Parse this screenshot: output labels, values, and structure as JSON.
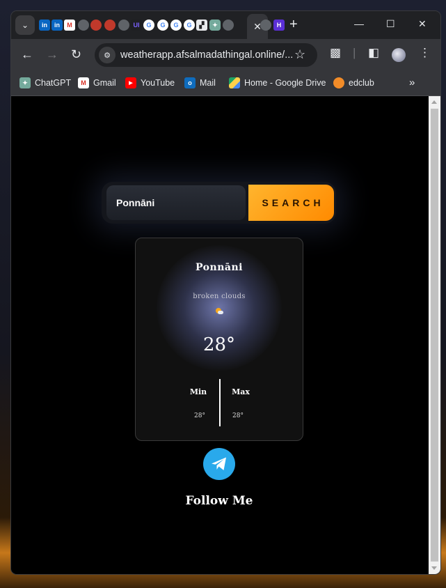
{
  "browser": {
    "tabs_menu_icon": "chevron-down-icon",
    "tab_favicons": [
      "linkedin",
      "linkedin",
      "gmail",
      "globe",
      "red-blob",
      "red-blob",
      "globe",
      "ui",
      "google",
      "google",
      "google",
      "google",
      "mixed",
      "chatgpt",
      "globe"
    ],
    "active_tab_close": "✕",
    "after_tabs_favicons": [
      "globe",
      "hc"
    ],
    "new_tab": "+",
    "url": "weatherapp.afsalmadathingal.online/...",
    "bookmarks": [
      {
        "label": "ChatGPT",
        "icon": "chatgpt-icon",
        "color": "#74aa9c"
      },
      {
        "label": "Gmail",
        "icon": "gmail-icon",
        "color": "#ffffff"
      },
      {
        "label": "YouTube",
        "icon": "youtube-icon",
        "color": "#ff0000"
      },
      {
        "label": "Mail",
        "icon": "outlook-icon",
        "color": "#0f6cbd"
      },
      {
        "label": "Home - Google Drive",
        "icon": "google-drive-icon",
        "color": "#1fa463"
      },
      {
        "label": "edclub",
        "icon": "edclub-icon",
        "color": "#f28c28"
      }
    ]
  },
  "app": {
    "search": {
      "value": "Ponnāni",
      "button_label": "SEARCH"
    },
    "weather": {
      "city": "Ponnāni",
      "description": "broken clouds",
      "icon": "sun-cloud-icon",
      "temperature": "28°",
      "min_label": "Min",
      "min_value": "28°",
      "max_label": "Max",
      "max_value": "28°"
    },
    "social": {
      "icon": "telegram-icon",
      "follow_text": "Follow Me"
    }
  },
  "colors": {
    "accent_orange": "#ff8a00",
    "telegram_blue": "#29a9eb",
    "page_background": "#000000"
  }
}
